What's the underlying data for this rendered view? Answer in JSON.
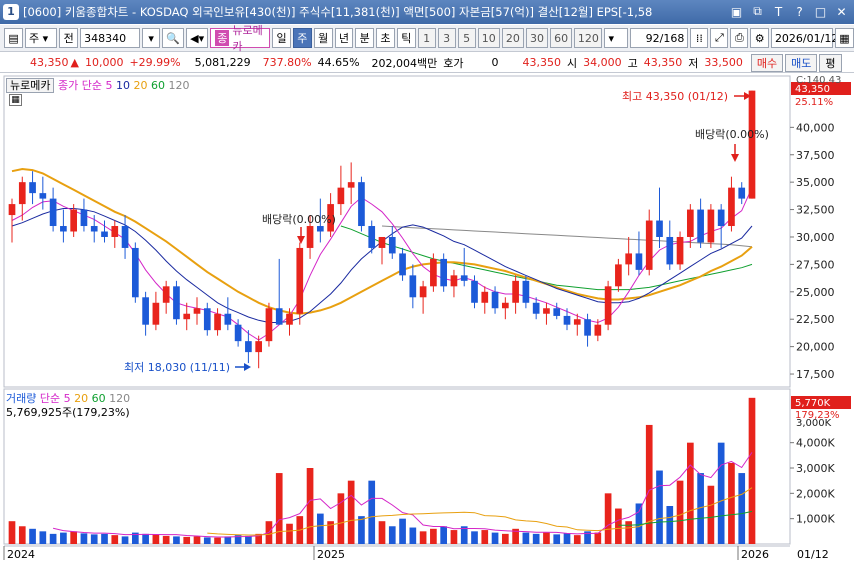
{
  "titlebar": {
    "window_num": "1",
    "text": "[0600] 키움종합차트 - KOSDAQ 외국인보유[430(천)] 주식수[11,381(천)] 액면[500] 자본금[57(억)] 결산[12월] EPS[-1,58",
    "controls": [
      "restore-icon",
      "pin-icon",
      "text-icon",
      "help-icon",
      "window-icon",
      "close-icon"
    ]
  },
  "toolbar": {
    "period": "주",
    "prev_label": "전",
    "code": "348340",
    "stock_name": "뉴로메카",
    "stock_badge": "종",
    "intervals": [
      "일",
      "주",
      "월",
      "년",
      "분",
      "초",
      "틱"
    ],
    "selected_interval": "주",
    "numbers": [
      "1",
      "3",
      "5",
      "10",
      "20",
      "30",
      "60",
      "120"
    ],
    "count": "92",
    "count_total": "/168",
    "date": "2026/01/12"
  },
  "quote": {
    "price": "43,350",
    "change": "10,000",
    "change_pct": "+29.99%",
    "volume": "5,081,229",
    "vol_ratio": "737.80%",
    "turnover": "44.65%",
    "amount": "202,004백만",
    "hoga_label": "호가",
    "hoga": "0",
    "hoga_price": "43,350",
    "open_label": "시",
    "open": "34,000",
    "high_label": "고",
    "high": "43,350",
    "low_label": "저",
    "low": "33,500",
    "buttons": [
      "매수",
      "매도",
      "평"
    ]
  },
  "price_panel": {
    "name_label": "뉴로메카",
    "ma_legend": {
      "prefix": "종가 단순",
      "periods": [
        "5",
        "10",
        "20",
        "60",
        "120"
      ]
    },
    "last_price_tag": "43,350",
    "last_pct_tag": "25.11%",
    "top_tag": "C:140.43",
    "y_ticks": [
      "40,000",
      "37,500",
      "35,000",
      "32,500",
      "30,000",
      "27,500",
      "25,000",
      "22,500",
      "20,000",
      "17,500"
    ],
    "annotations": {
      "high": "최고 43,350 (01/12)",
      "low": "최저 18,030 (11/11)",
      "div1": "배당락(0.00%)",
      "div2": "배당락(0.00%)"
    }
  },
  "volume_panel": {
    "legend_name": "거래량",
    "legend_prefix": "단순",
    "periods": [
      "5",
      "20",
      "60",
      "120"
    ],
    "value_line": "5,769,925주(179,23%)",
    "last_tag": "5,770K",
    "last_pct_tag": "179,23%",
    "y_ticks": [
      "4,000K",
      "3,000K",
      "2,000K",
      "1,000K"
    ],
    "top_tick": "3,000K"
  },
  "x_axis": {
    "labels": [
      "2024",
      "2025",
      "2026"
    ],
    "cursor_date": "01/12"
  },
  "colors": {
    "up": "#e8241c",
    "down": "#1c5ad8",
    "ma5": "#d426c8",
    "ma10": "#1a2aa0",
    "ma20": "#e8a010",
    "ma60": "#10a030",
    "ma120": "#888888"
  },
  "chart_data": [
    {
      "type": "candlestick",
      "title": "뉴로메카 주봉",
      "ylim": [
        16500,
        44500
      ],
      "candles": [
        [
          32000,
          33500,
          29500,
          33000
        ],
        [
          33000,
          35500,
          31500,
          35000
        ],
        [
          35000,
          36000,
          33000,
          34000
        ],
        [
          34000,
          35500,
          32500,
          33500
        ],
        [
          33500,
          34500,
          30500,
          31000
        ],
        [
          31000,
          32500,
          29500,
          30500
        ],
        [
          30500,
          33000,
          30000,
          32500
        ],
        [
          32500,
          33500,
          30500,
          31000
        ],
        [
          31000,
          32000,
          29500,
          30500
        ],
        [
          30500,
          31500,
          29500,
          30000
        ],
        [
          30000,
          31500,
          29000,
          31000
        ],
        [
          31000,
          32000,
          28000,
          29000
        ],
        [
          29000,
          29500,
          24000,
          24500
        ],
        [
          24500,
          25000,
          21000,
          22000
        ],
        [
          22000,
          25000,
          21500,
          24000
        ],
        [
          24000,
          26000,
          23000,
          25500
        ],
        [
          25500,
          26000,
          22000,
          22500
        ],
        [
          22500,
          24000,
          21500,
          23000
        ],
        [
          23000,
          24500,
          22000,
          23500
        ],
        [
          23500,
          24000,
          21000,
          21500
        ],
        [
          21500,
          23500,
          21000,
          23000
        ],
        [
          23000,
          24500,
          21500,
          22000
        ],
        [
          22000,
          22500,
          20000,
          20500
        ],
        [
          20500,
          21500,
          18500,
          19500
        ],
        [
          19500,
          21000,
          18030,
          20500
        ],
        [
          20500,
          24000,
          20000,
          23500
        ],
        [
          23500,
          28000,
          22500,
          22000
        ],
        [
          22000,
          23500,
          21000,
          23000
        ],
        [
          23000,
          29500,
          22000,
          29000
        ],
        [
          29000,
          32000,
          28000,
          31000
        ],
        [
          31000,
          33500,
          29500,
          30500
        ],
        [
          30500,
          34000,
          30000,
          33000
        ],
        [
          33000,
          36500,
          32000,
          34500
        ],
        [
          34500,
          36800,
          33000,
          35000
        ],
        [
          35000,
          35500,
          30500,
          31000
        ],
        [
          31000,
          31500,
          28500,
          29000
        ],
        [
          29000,
          30000,
          27500,
          30000
        ],
        [
          30000,
          31000,
          28000,
          28500
        ],
        [
          28500,
          29000,
          26000,
          26500
        ],
        [
          26500,
          27500,
          23500,
          24500
        ],
        [
          24500,
          26000,
          23000,
          25500
        ],
        [
          25500,
          28500,
          25000,
          28000
        ],
        [
          28000,
          28500,
          25000,
          25500
        ],
        [
          25500,
          27000,
          24500,
          26500
        ],
        [
          26500,
          29000,
          25500,
          26000
        ],
        [
          26000,
          26500,
          23500,
          24000
        ],
        [
          24000,
          25500,
          23000,
          25000
        ],
        [
          25000,
          25500,
          23000,
          23500
        ],
        [
          23500,
          24500,
          22500,
          24000
        ],
        [
          24000,
          26500,
          23000,
          26000
        ],
        [
          26000,
          26500,
          23500,
          24000
        ],
        [
          24000,
          24500,
          22500,
          23000
        ],
        [
          23000,
          24000,
          22000,
          23500
        ],
        [
          23500,
          24000,
          22500,
          22800
        ],
        [
          22800,
          23500,
          21500,
          22000
        ],
        [
          22000,
          23000,
          21000,
          22500
        ],
        [
          22500,
          23000,
          20000,
          21000
        ],
        [
          21000,
          22500,
          20500,
          22000
        ],
        [
          22000,
          26000,
          21500,
          25500
        ],
        [
          25500,
          28000,
          25000,
          27500
        ],
        [
          27500,
          30000,
          26500,
          28500
        ],
        [
          28500,
          30500,
          26500,
          27000
        ],
        [
          27000,
          32500,
          26500,
          31500
        ],
        [
          31500,
          34500,
          29000,
          30000
        ],
        [
          30000,
          31500,
          27000,
          27500
        ],
        [
          27500,
          30500,
          27000,
          30000
        ],
        [
          30000,
          33000,
          29000,
          32500
        ],
        [
          32500,
          33500,
          29000,
          29500
        ],
        [
          29500,
          33000,
          29000,
          32500
        ],
        [
          32500,
          33000,
          29000,
          31000
        ],
        [
          31000,
          35500,
          30500,
          34500
        ],
        [
          34500,
          35000,
          33000,
          33500
        ],
        [
          33500,
          43350,
          33500,
          43350
        ]
      ],
      "ma": {
        "ma5": [
          31500,
          32000,
          32700,
          33200,
          33300,
          32800,
          32400,
          32000,
          31600,
          31000,
          30400,
          29800,
          28500,
          27000,
          25800,
          24800,
          24000,
          23700,
          23500,
          23300,
          23000,
          22700,
          22000,
          21200,
          20600,
          21200,
          22000,
          22800,
          24300,
          26500,
          28400,
          29800,
          31300,
          32800,
          33600,
          33000,
          32300,
          31200,
          29900,
          28500,
          27300,
          26600,
          26200,
          26000,
          26300,
          26000,
          25400,
          25000,
          24800,
          24800,
          24600,
          24300,
          24000,
          23600,
          23200,
          22800,
          22400,
          22200,
          22600,
          23600,
          25000,
          26500,
          27800,
          28800,
          29300,
          29500,
          29600,
          30100,
          30500,
          30800,
          31700,
          32400,
          34500
        ],
        "ma10": [
          31000,
          31300,
          31700,
          32100,
          32400,
          32600,
          32600,
          32500,
          32300,
          31900,
          31500,
          31100,
          30500,
          29700,
          28800,
          27800,
          26900,
          26100,
          25400,
          24700,
          24000,
          23500,
          23100,
          22700,
          22400,
          22200,
          22200,
          22300,
          22600,
          23200,
          24000,
          24800,
          25800,
          27000,
          28000,
          28800,
          29600,
          30300,
          30900,
          31100,
          30900,
          30500,
          30100,
          29600,
          29300,
          28800,
          28300,
          27800,
          27300,
          26900,
          26500,
          26100,
          25700,
          25300,
          25000,
          24700,
          24400,
          24100,
          24000,
          24000,
          24100,
          24400,
          24900,
          25500,
          26100,
          26700,
          27300,
          27900,
          28500,
          28900,
          29400,
          29900,
          31000
        ],
        "ma20": [
          36000,
          36200,
          36100,
          35800,
          35300,
          34800,
          34300,
          33800,
          33300,
          32800,
          32300,
          31900,
          31400,
          30800,
          30200,
          29600,
          28900,
          28200,
          27500,
          26800,
          26200,
          25600,
          25000,
          24500,
          24000,
          23600,
          23300,
          23100,
          23000,
          23100,
          23300,
          23600,
          24000,
          24500,
          25000,
          25500,
          26000,
          26500,
          27000,
          27300,
          27500,
          27600,
          27700,
          27700,
          27600,
          27500,
          27300,
          27100,
          26900,
          26600,
          26300,
          26000,
          25700,
          25400,
          25100,
          24800,
          24600,
          24400,
          24300,
          24300,
          24400,
          24500,
          24700,
          25000,
          25300,
          25600,
          26000,
          26400,
          26900,
          27300,
          27800,
          28300,
          29100
        ],
        "ma60": [
          null,
          null,
          null,
          null,
          null,
          null,
          null,
          null,
          null,
          null,
          null,
          null,
          null,
          null,
          null,
          null,
          null,
          null,
          null,
          null,
          null,
          null,
          null,
          null,
          null,
          null,
          null,
          null,
          null,
          null,
          null,
          null,
          31000,
          30700,
          30300,
          29900,
          29500,
          29200,
          28900,
          28600,
          28300,
          28000,
          27800,
          27600,
          27400,
          27200,
          27000,
          26800,
          26600,
          26400,
          26200,
          26000,
          25800,
          25600,
          25500,
          25400,
          25300,
          25200,
          25200,
          25200,
          25200,
          25300,
          25400,
          25600,
          25800,
          26000,
          26200,
          26400,
          26600,
          26800,
          27000,
          27200,
          27500
        ],
        "ma120": [
          null,
          null,
          null,
          null,
          null,
          null,
          null,
          null,
          null,
          null,
          null,
          null,
          null,
          null,
          null,
          null,
          null,
          null,
          null,
          null,
          null,
          null,
          null,
          null,
          null,
          null,
          null,
          null,
          null,
          null,
          null,
          null,
          null,
          null,
          null,
          null,
          31000,
          30950,
          30900,
          30850,
          30800,
          30750,
          30700,
          30650,
          30600,
          30550,
          30500,
          30450,
          30400,
          30350,
          30300,
          30250,
          30200,
          30150,
          30100,
          30050,
          30000,
          29950,
          29900,
          29850,
          29800,
          29750,
          29700,
          29650,
          29600,
          29550,
          29500,
          29450,
          29400,
          29350,
          29300,
          29200,
          29100
        ]
      }
    },
    {
      "type": "bar",
      "title": "거래량",
      "ylim": [
        0,
        6000
      ],
      "unit": "K",
      "values": [
        900,
        700,
        600,
        500,
        400,
        450,
        500,
        420,
        380,
        400,
        350,
        300,
        450,
        400,
        380,
        320,
        300,
        280,
        300,
        260,
        250,
        300,
        350,
        320,
        400,
        900,
        2800,
        800,
        1100,
        3000,
        1200,
        900,
        2000,
        2500,
        1100,
        2500,
        900,
        700,
        1000,
        650,
        500,
        600,
        700,
        550,
        700,
        500,
        550,
        450,
        400,
        600,
        450,
        400,
        450,
        380,
        420,
        350,
        500,
        450,
        2000,
        1400,
        900,
        1600,
        4700,
        2900,
        1500,
        2500,
        4000,
        2800,
        2300,
        4000,
        3200,
        2800,
        5770
      ],
      "up": [
        1,
        1,
        0,
        0,
        0,
        0,
        1,
        0,
        0,
        0,
        1,
        0,
        0,
        0,
        1,
        1,
        0,
        1,
        1,
        0,
        1,
        0,
        0,
        0,
        1,
        1,
        1,
        1,
        1,
        1,
        0,
        1,
        1,
        1,
        0,
        0,
        1,
        0,
        0,
        0,
        1,
        1,
        0,
        1,
        0,
        0,
        1,
        0,
        1,
        1,
        0,
        0,
        1,
        0,
        0,
        1,
        0,
        1,
        1,
        1,
        1,
        0,
        1,
        0,
        0,
        1,
        1,
        0,
        1,
        0,
        1,
        0,
        1
      ]
    }
  ]
}
